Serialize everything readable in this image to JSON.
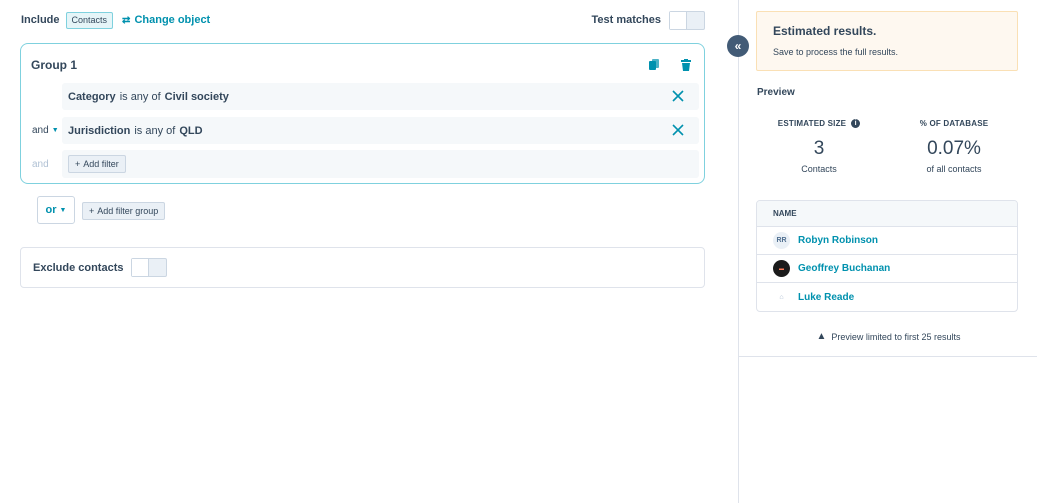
{
  "filter_builder": {
    "include_label": "Include",
    "object_chip": "Contacts",
    "change_object_label": "Change object",
    "test_matches_label": "Test matches",
    "group": {
      "title": "Group 1",
      "filters": [
        {
          "connector": "",
          "property": "Category",
          "operator": "is any of",
          "value": "Civil society"
        },
        {
          "connector": "and",
          "property": "Jurisdiction",
          "operator": "is any of",
          "value": "QLD"
        }
      ],
      "add_row_connector": "and",
      "add_filter_label": "Add filter"
    },
    "or_label": "or",
    "add_filter_group_label": "Add filter group",
    "exclude_label": "Exclude contacts"
  },
  "sidebar": {
    "alert_title": "Estimated results.",
    "alert_body": "Save to process the full results.",
    "preview_title": "Preview",
    "stats": [
      {
        "label": "ESTIMATED SIZE",
        "value": "3",
        "sub": "Contacts"
      },
      {
        "label": "% OF DATABASE",
        "value": "0.07%",
        "sub": "of all contacts"
      }
    ],
    "table_header": "NAME",
    "results": [
      {
        "initials": "RR",
        "name": "Robyn Robinson"
      },
      {
        "initials": "GB",
        "name": "Geoffrey Buchanan"
      },
      {
        "initials": "",
        "name": "Luke Reade"
      }
    ],
    "limit_note": "Preview limited to first 25 results"
  },
  "icons": {
    "swap": "swap-icon",
    "copy": "copy-icon",
    "trash": "trash-icon",
    "close": "close-icon",
    "collapse": "double-chevron-left-icon",
    "info": "info-icon",
    "warning": "warning-icon"
  },
  "colors": {
    "accent": "#0091ae",
    "border_active": "#7fd1de",
    "text": "#33475b",
    "alert_bg": "#fef8f0"
  }
}
